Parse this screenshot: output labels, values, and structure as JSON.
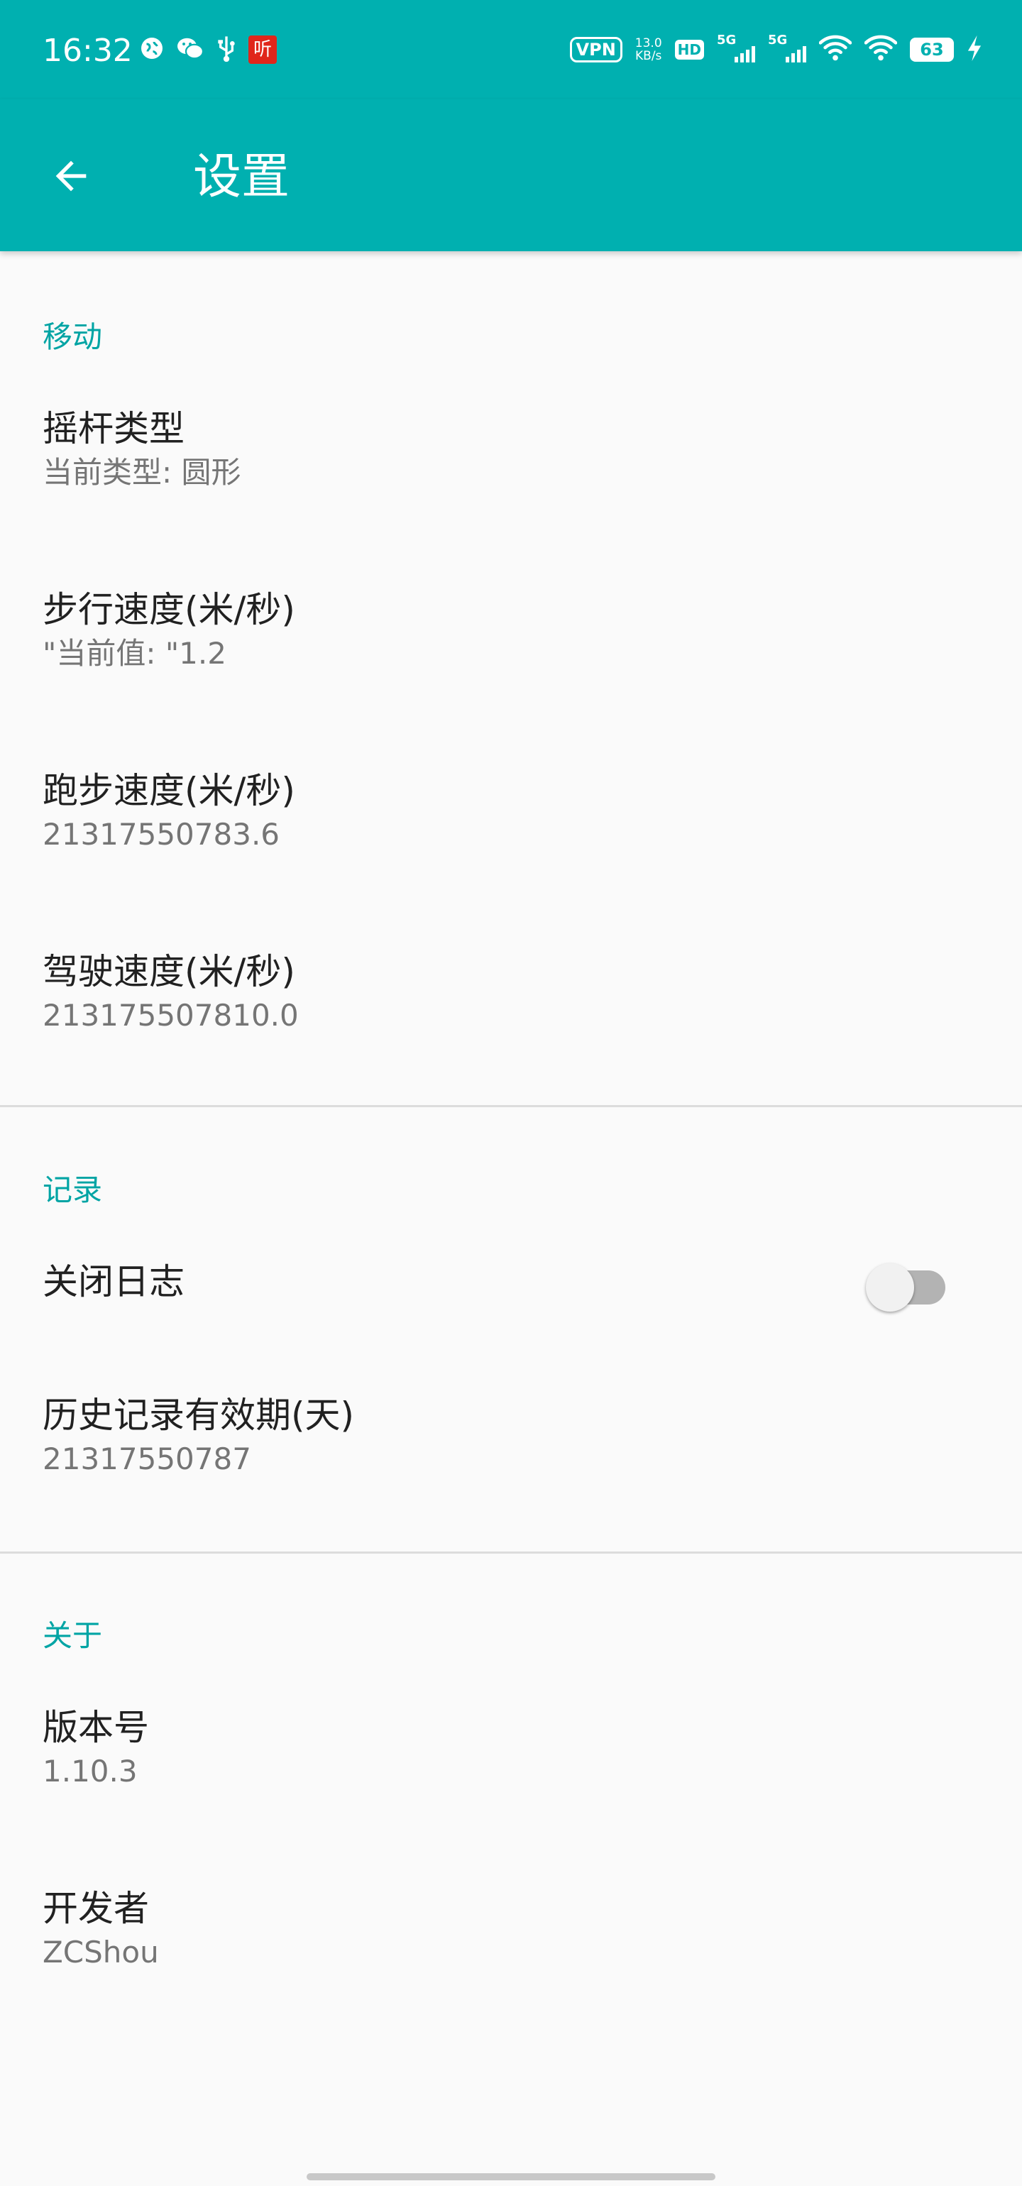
{
  "status_bar": {
    "time": "16:32",
    "app_icon_label": "听",
    "vpn": "VPN",
    "speed_value": "13.0",
    "speed_unit": "KB/s",
    "hd": "HD",
    "network1": "5G",
    "network2": "5G",
    "battery": "63",
    "icons": [
      "globe-icon",
      "wechat-icon",
      "usb-icon",
      "app-icon",
      "signal-icon",
      "wifi-icon",
      "charging-icon"
    ]
  },
  "app_bar": {
    "title": "设置",
    "back_icon": "arrow-left-icon",
    "color": "#00b0b0"
  },
  "categories": [
    {
      "title": "移动",
      "items": [
        {
          "title": "摇杆类型",
          "summary": "当前类型: 圆形"
        },
        {
          "title": "步行速度(米/秒)",
          "summary": "\"当前值: \"1.2"
        },
        {
          "title": "跑步速度(米/秒)",
          "summary": "21317550783.6"
        },
        {
          "title": "驾驶速度(米/秒)",
          "summary": "213175507810.0"
        }
      ]
    },
    {
      "title": "记录",
      "items": [
        {
          "title": "关闭日志",
          "switch_on": false
        },
        {
          "title": "历史记录有效期(天)",
          "summary": "21317550787"
        }
      ]
    },
    {
      "title": "关于",
      "items": [
        {
          "title": "版本号",
          "summary": "1.10.3"
        },
        {
          "title": "开发者",
          "summary": "ZCShou"
        }
      ]
    }
  ],
  "accent_color": "#00a4a4"
}
